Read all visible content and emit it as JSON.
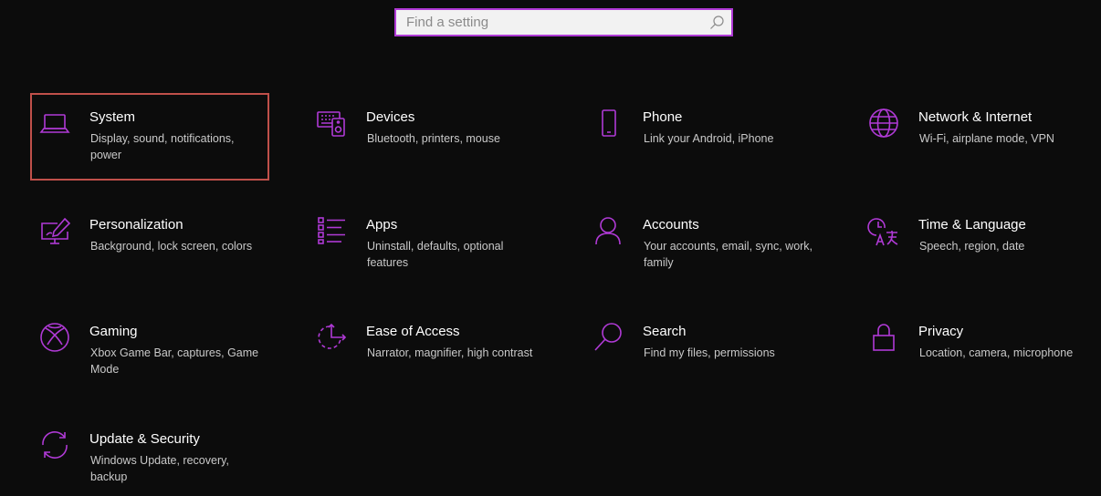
{
  "search": {
    "placeholder": "Find a setting",
    "value": ""
  },
  "colors": {
    "accent": "#b03ad6",
    "icon": "#b03ad6",
    "focus_border": "#c0504a",
    "background": "#0c0c0c"
  },
  "tiles": [
    {
      "id": "system",
      "title": "System",
      "desc": "Display, sound, notifications, power",
      "icon": "laptop-icon"
    },
    {
      "id": "devices",
      "title": "Devices",
      "desc": "Bluetooth, printers, mouse",
      "icon": "devices-icon"
    },
    {
      "id": "phone",
      "title": "Phone",
      "desc": "Link your Android, iPhone",
      "icon": "phone-icon"
    },
    {
      "id": "network",
      "title": "Network & Internet",
      "desc": "Wi-Fi, airplane mode, VPN",
      "icon": "globe-icon"
    },
    {
      "id": "personalization",
      "title": "Personalization",
      "desc": "Background, lock screen, colors",
      "icon": "paint-icon"
    },
    {
      "id": "apps",
      "title": "Apps",
      "desc": "Uninstall, defaults, optional features",
      "icon": "apps-list-icon"
    },
    {
      "id": "accounts",
      "title": "Accounts",
      "desc": "Your accounts, email, sync, work, family",
      "icon": "person-icon"
    },
    {
      "id": "time-language",
      "title": "Time & Language",
      "desc": "Speech, region, date",
      "icon": "time-language-icon"
    },
    {
      "id": "gaming",
      "title": "Gaming",
      "desc": "Xbox Game Bar, captures, Game Mode",
      "icon": "xbox-icon"
    },
    {
      "id": "ease-of-access",
      "title": "Ease of Access",
      "desc": "Narrator, magnifier, high contrast",
      "icon": "ease-of-access-icon"
    },
    {
      "id": "search",
      "title": "Search",
      "desc": "Find my files, permissions",
      "icon": "magnifier-icon"
    },
    {
      "id": "privacy",
      "title": "Privacy",
      "desc": "Location, camera, microphone",
      "icon": "lock-icon"
    },
    {
      "id": "update-security",
      "title": "Update & Security",
      "desc": "Windows Update, recovery, backup",
      "icon": "sync-icon"
    }
  ],
  "focused_tile": "system"
}
